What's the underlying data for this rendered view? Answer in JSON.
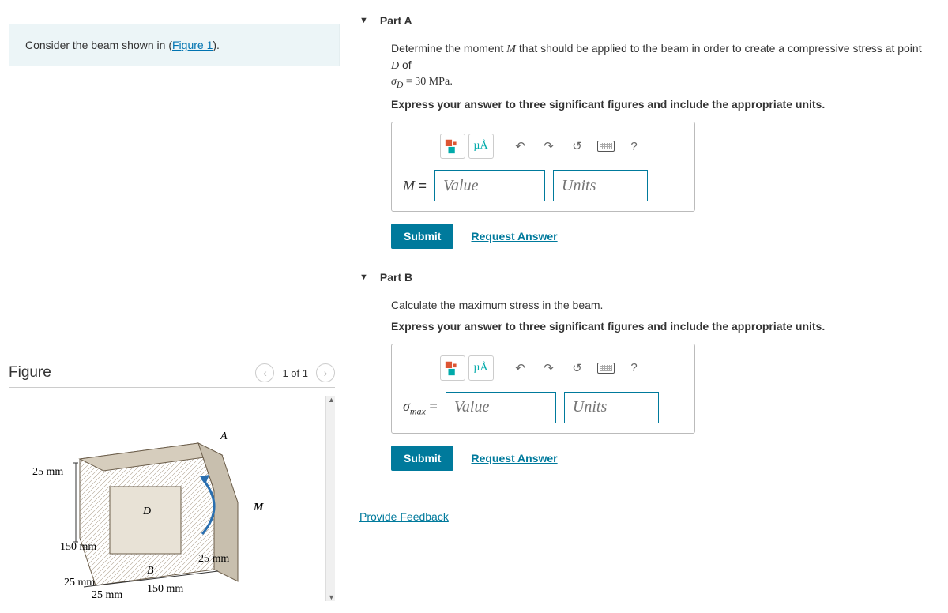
{
  "problem": {
    "intro_pre": "Consider the beam shown in (",
    "intro_link": "Figure 1",
    "intro_post": ")."
  },
  "figure": {
    "title": "Figure",
    "counter": "1 of 1",
    "labels": {
      "A": "A",
      "B": "B",
      "D": "D",
      "M": "M",
      "dim_25mm_tl": "25 mm",
      "dim_150mm_left": "150 mm",
      "dim_25mm_bl": "25 mm",
      "dim_25mm_bl2": "25 mm",
      "dim_150mm_bot": "150 mm",
      "dim_25mm_br": "25 mm"
    }
  },
  "partA": {
    "title": "Part A",
    "question_pre": "Determine the moment ",
    "question_mid1": " that should be applied to the beam in order to create a compressive stress at point ",
    "sigma_line_pre": " = 30 ",
    "mpa": "MPa",
    "period": ".",
    "instruction": "Express your answer to three significant figures and include the appropriate units.",
    "var": "M",
    "equals": "=",
    "value_ph": "Value",
    "units_ph": "Units",
    "submit": "Submit",
    "request": "Request Answer",
    "mu_a": "µÅ",
    "help": "?",
    "D": "D",
    "of_text": " of ",
    "sigmaD": "σD"
  },
  "partB": {
    "title": "Part B",
    "question": "Calculate the maximum stress in the beam.",
    "instruction": "Express your answer to three significant figures and include the appropriate units.",
    "var_html": "σmax",
    "equals": "=",
    "value_ph": "Value",
    "units_ph": "Units",
    "submit": "Submit",
    "request": "Request Answer",
    "mu_a": "µÅ",
    "help": "?"
  },
  "feedback": {
    "label": "Provide Feedback"
  }
}
